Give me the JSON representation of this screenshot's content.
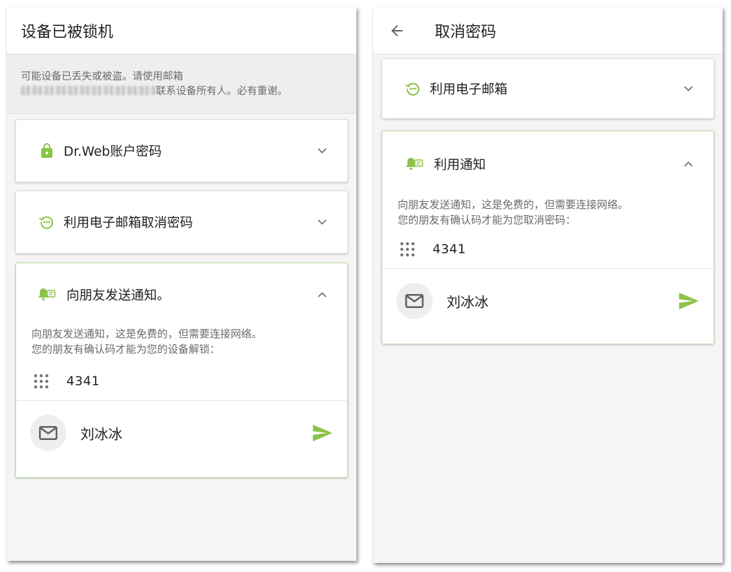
{
  "left": {
    "title": "设备已被锁机",
    "banner": {
      "line1": "可能设备已丢失或被盗。请使用邮箱",
      "line2_suffix": "联系设备所有人。必有重谢。"
    },
    "cards": {
      "drweb": {
        "label": "Dr.Web账户密码"
      },
      "email": {
        "label": "利用电子邮箱取消密码"
      },
      "notify": {
        "label": "向朋友发送通知。",
        "desc_line1": "向朋友发送通知，这是免费的，但需要连接网络。",
        "desc_line2": "您的朋友有确认码才能为您的设备解锁：",
        "code": "4341",
        "contact_name": "刘冰冰"
      }
    }
  },
  "right": {
    "title": "取消密码",
    "cards": {
      "email": {
        "label": "利用电子邮箱"
      },
      "notify": {
        "label": "利用通知",
        "desc_line1": "向朋友发送通知，这是免费的，但需要连接网络。",
        "desc_line2": "您的朋友有确认码才能为您取消密码：",
        "code": "4341",
        "contact_name": "刘冰冰"
      }
    }
  },
  "colors": {
    "accent_green": "#8bc34a",
    "chevron_gray": "#757575",
    "icon_gray": "#616161"
  },
  "icons": {
    "lock": "lock-icon",
    "restore": "restore-dots-icon",
    "notify": "bell-message-icon",
    "code": "dialpad-icon",
    "mail": "mail-icon",
    "send": "send-icon",
    "back": "arrow-back-icon",
    "chevron_down": "chevron-down-icon",
    "chevron_up": "chevron-up-icon"
  }
}
